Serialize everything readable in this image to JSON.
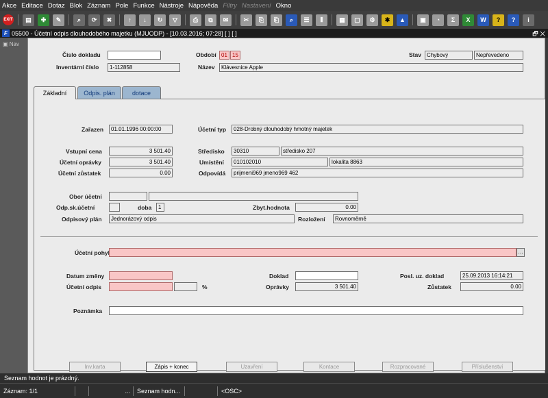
{
  "menu": [
    "Akce",
    "Editace",
    "Dotaz",
    "Blok",
    "Záznam",
    "Pole",
    "Funkce",
    "Nástroje",
    "Nápověda",
    "Filtry",
    "Nastavení",
    "Okno"
  ],
  "menu_disabled": [
    "Filtry",
    "Nastavení"
  ],
  "toolbar": {
    "exit_label": "EXIT"
  },
  "window": {
    "icon_label": "F",
    "title": "05500 - Účetní odpis dlouhodobého majetku (MJUODP) - [10.03.2016; 07:28] [ ] [ ]",
    "controls": "🗗 ✕"
  },
  "nav": {
    "label": "Nav"
  },
  "header": {
    "cislo_dokladu_label": "Číslo dokladu",
    "cislo_dokladu_value": "",
    "inventarni_cislo_label": "Inventární číslo",
    "inventarni_cislo_value": "1-112858",
    "obdobi_label": "Období",
    "obdobi_month": "01",
    "obdobi_year": "15",
    "nazev_label": "Název",
    "nazev_value": "Klávesnice Apple",
    "stav_label": "Stav",
    "stav_value1": "Chybový",
    "stav_value2": "Nepřevedeno"
  },
  "tabs": [
    {
      "label": "Základní",
      "active": true
    },
    {
      "label": "Odpis. plán",
      "active": false
    },
    {
      "label": "dotace",
      "active": false
    }
  ],
  "main": {
    "zarazen_label": "Zařazen",
    "zarazen_value": "01.01.1996 00:00:00",
    "ucetni_typ_label": "Účetní typ",
    "ucetni_typ_value": "028-Drobný dlouhodobý hmotný majetek",
    "vstupni_cena_label": "Vstupní cena",
    "vstupni_cena_value": "3 501.40",
    "ucetni_opravky_label": "Účetní oprávky",
    "ucetni_opravky_value": "3 501.40",
    "ucetni_zustatek_label": "Účetní zůstatek",
    "ucetni_zustatek_value": "0.00",
    "stredisko_label": "Středisko",
    "stredisko_code": "30310",
    "stredisko_name": "středisko 207",
    "umisteni_label": "Umístění",
    "umisteni_code": "010102010",
    "umisteni_name": "lokalita 8863",
    "odpovida_label": "Odpovídá",
    "odpovida_value": "prijmeni969 jmeno969 462",
    "obor_ucetni_label": "Obor účetní",
    "obor_ucetni_code": "",
    "obor_ucetni_name": "",
    "odp_sk_label": "Odp.sk.účetní",
    "odp_sk_value": "",
    "doba_label": "doba",
    "doba_value": "1",
    "zbyt_hodnota_label": "Zbyt.hodnota",
    "zbyt_hodnota_value": "0.00",
    "odpisovy_plan_label": "Odpisový plán",
    "odpisovy_plan_value": "Jednorázový odpis",
    "rozlozeni_label": "Rozložení",
    "rozlozeni_value": "Rovnoměrně"
  },
  "bottom": {
    "ucetni_pohyb_label": "Účetní pohyb",
    "ucetni_pohyb_value": "",
    "ellipsis": "…",
    "datum_zmeny_label": "Datum změny",
    "datum_zmeny_value": "",
    "ucetni_odpis_label": "Účetní odpis",
    "ucetni_odpis_value": "",
    "ucetni_odpis_pct": "",
    "pct_sign": "%",
    "doklad_label": "Doklad",
    "doklad_value": "",
    "opravky_label": "Oprávky",
    "opravky_value": "3 501.40",
    "posl_uz_doklad_label": "Posl. uz. doklad",
    "posl_uz_doklad_value": "25.09.2013 16:14:21",
    "zustatek_label": "Zůstatek",
    "zustatek_value": "0.00",
    "poznamka_label": "Poznámka",
    "poznamka_value": ""
  },
  "buttons": [
    {
      "label": "Inv.karta",
      "enabled": false
    },
    {
      "label": "Zápis + konec",
      "enabled": true
    },
    {
      "label": "Uzavření",
      "enabled": false
    },
    {
      "label": "Kontace",
      "enabled": false
    },
    {
      "label": "Rozpracované",
      "enabled": false
    },
    {
      "label": "Příslušenství",
      "enabled": false
    }
  ],
  "status": {
    "message": "Seznam hodnot je prázdný.",
    "record": "Záznam: 1/1",
    "cell2": "",
    "cell3": "...",
    "cell4": "Seznam hodn...",
    "cell5": "",
    "cell6": "<OSC>"
  }
}
